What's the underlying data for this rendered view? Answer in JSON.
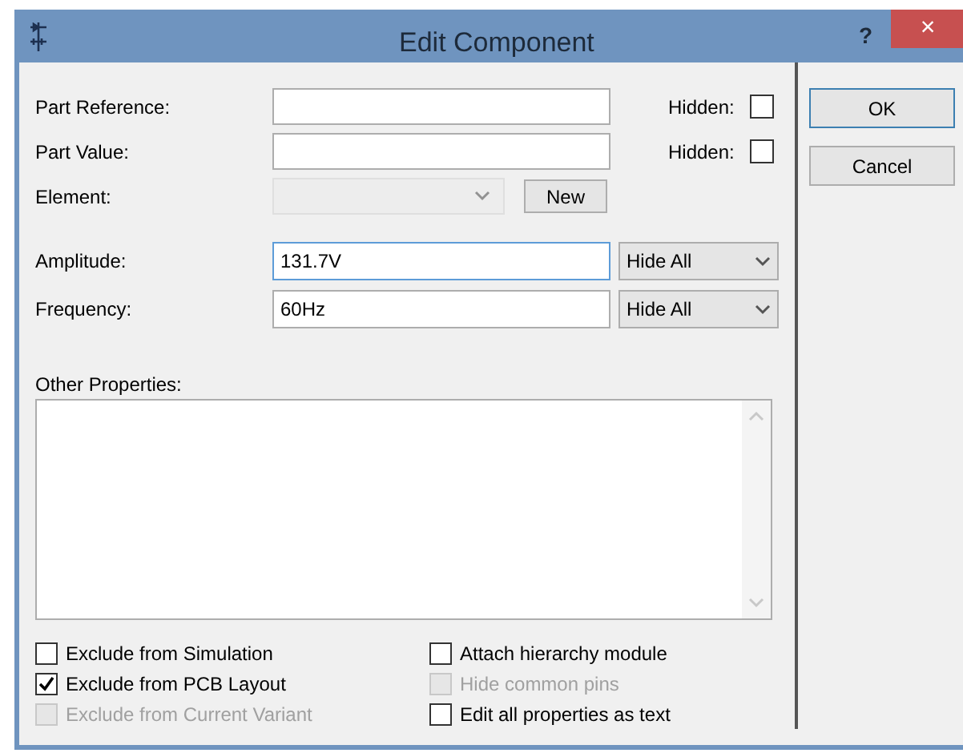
{
  "window": {
    "title": "Edit Component",
    "help": "?",
    "close": "×"
  },
  "fields": [
    {
      "label": "Part Reference:",
      "hidden_label": "Hidden:",
      "hidden": false
    },
    {
      "label": "Part Value:",
      "hidden_label": "Hidden:",
      "hidden": false
    }
  ],
  "element": {
    "label": "Element:",
    "disabled": true,
    "button": "New"
  },
  "properties": [
    {
      "label": "Amplitude:",
      "value": "131.7V",
      "visibility": "Hide All",
      "focused": true
    },
    {
      "label": "Frequency:",
      "value": "60Hz",
      "visibility": "Hide All",
      "focused": false
    }
  ],
  "other_properties": {
    "label": "Other Properties:"
  },
  "options_left": [
    {
      "label": "Exclude from Simulation",
      "checked": false,
      "disabled": false
    },
    {
      "label": "Exclude from PCB Layout",
      "checked": true,
      "disabled": false
    },
    {
      "label": "Exclude from Current Variant",
      "checked": false,
      "disabled": true
    }
  ],
  "options_right": [
    {
      "label": "Attach hierarchy module",
      "checked": false,
      "disabled": false
    },
    {
      "label": "Hide common pins",
      "checked": false,
      "disabled": true
    },
    {
      "label": "Edit all properties as text",
      "checked": false,
      "disabled": false
    }
  ],
  "buttons": [
    {
      "label": "OK",
      "default": true
    },
    {
      "label": "Cancel",
      "default": false
    }
  ]
}
